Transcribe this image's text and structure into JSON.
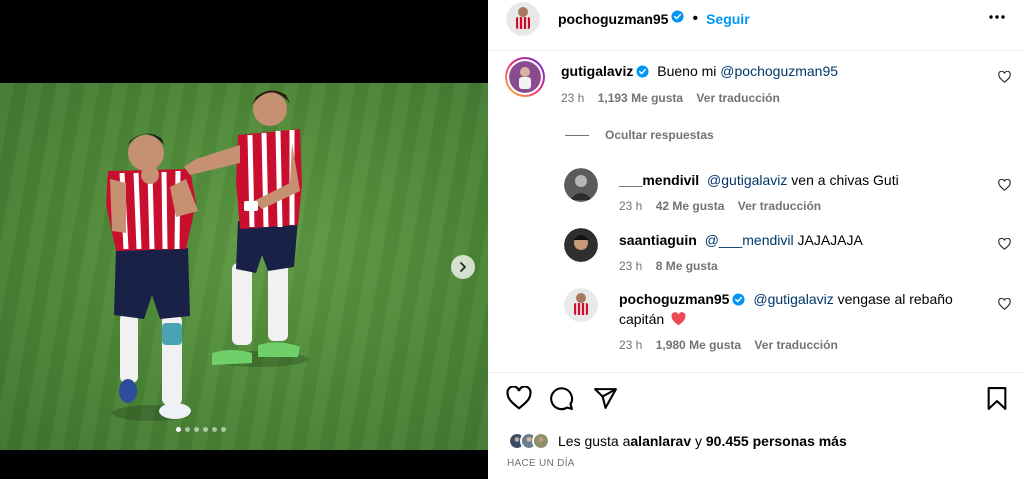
{
  "post": {
    "author": "pochoguzman95",
    "follow_label": "Seguir"
  },
  "colors": {
    "link": "#0095f6",
    "mention": "#00376b",
    "muted": "#737373",
    "like_red": "#ed4956",
    "verified": "#0095f6"
  },
  "media": {
    "slide_count": 6,
    "active_slide": 1,
    "next_icon": "chevron-right-icon"
  },
  "comments": [
    {
      "user": "gutigalaviz",
      "verified": true,
      "mention": "@pochoguzman95",
      "text_before": "Bueno mi ",
      "text_after": "",
      "time": "23 h",
      "likes": "1,193 Me gusta",
      "translate": "Ver traducción"
    }
  ],
  "hide_replies_label": "Ocultar respuestas",
  "replies": [
    {
      "user": "___mendivil",
      "mention": "@gutigalaviz",
      "text": " ven a chivas Guti",
      "time": "23 h",
      "likes": "42 Me gusta",
      "translate": "Ver traducción"
    },
    {
      "user": "saantiaguin",
      "mention": "@___mendivil",
      "text": " JAJAJAJA",
      "time": "23 h",
      "likes": "8 Me gusta",
      "translate": ""
    },
    {
      "user": "pochoguzman95",
      "verified": true,
      "mention": "@gutigalaviz",
      "text": " vengase al rebaño",
      "text_line2": "capitán",
      "emoji": "red-heart-icon",
      "time": "23 h",
      "likes": "1,980 Me gusta",
      "translate": "Ver traducción"
    }
  ],
  "actions": {
    "like_icon": "heart-icon",
    "comment_icon": "comment-icon",
    "share_icon": "share-icon",
    "save_icon": "bookmark-icon"
  },
  "likes_summary": {
    "prefix": "Les gusta a ",
    "user": "alanlarav",
    "middle": " y ",
    "count": "90.455 personas más"
  },
  "time_ago": "HACE UN DÍA"
}
